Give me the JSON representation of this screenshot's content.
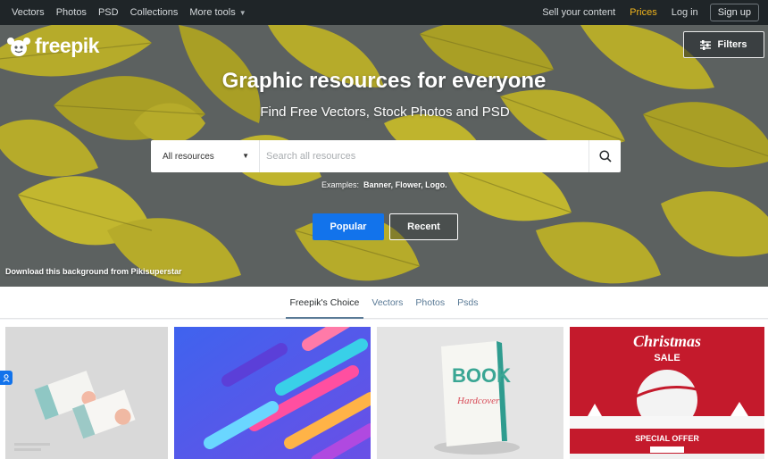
{
  "topnav": {
    "links": [
      "Vectors",
      "Photos",
      "PSD",
      "Collections"
    ],
    "more_tools": "More tools",
    "sell": "Sell your content",
    "prices": "Prices",
    "login": "Log in",
    "signup": "Sign up"
  },
  "brand": {
    "name": "freepik"
  },
  "hero": {
    "filters_label": "Filters",
    "headline": "Graphic resources for everyone",
    "subline": "Find Free Vectors, Stock Photos and PSD",
    "search": {
      "category": "All resources",
      "placeholder": "Search all resources"
    },
    "examples_label": "Examples:",
    "examples": [
      "Banner,",
      "Flower,",
      "Logo."
    ],
    "popular": "Popular",
    "recent": "Recent",
    "credit": "Download this background from Pikisuperstar"
  },
  "tabs": [
    "Freepik's Choice",
    "Vectors",
    "Photos",
    "Psds"
  ],
  "thumbs": {
    "t3_title": "BOOK",
    "t3_subtitle": "Hardcover",
    "t4_title": "Christmas",
    "t4_sale": "SALE",
    "t4_offer": "SPECIAL OFFER"
  },
  "colors": {
    "nav_bg": "#1f2528",
    "accent_blue": "#1273eb",
    "prices_yellow": "#f0b41c",
    "leaf": "#b3a928"
  }
}
